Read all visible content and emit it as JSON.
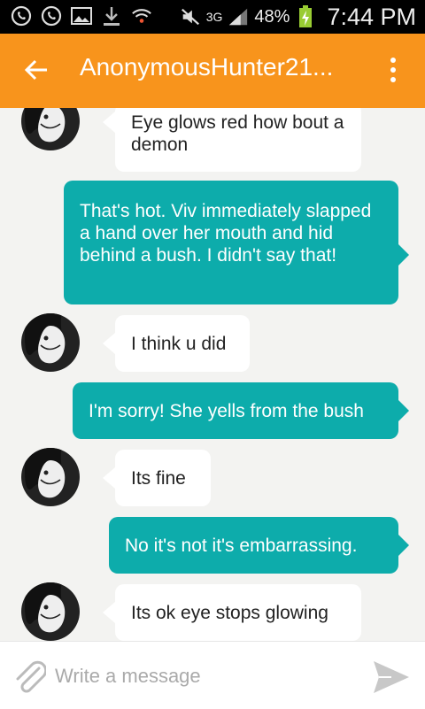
{
  "status_bar": {
    "icons": [
      "whatsapp-icon",
      "whatsapp-icon",
      "image-icon",
      "download-icon",
      "wifi-icon",
      "mute-icon",
      "3g-icon",
      "signal-icon",
      "battery-icon"
    ],
    "network": "3G",
    "battery": "48%",
    "time": "7:44 PM"
  },
  "app_bar": {
    "title": "AnonymousHunter21...",
    "back_icon": "arrow-left-icon",
    "menu_icon": "overflow-menu-icon",
    "color": "#f8941c"
  },
  "messages": [
    {
      "side": "in",
      "text": "Eye glows red how bout a demon"
    },
    {
      "side": "out",
      "text": "That's hot. Viv immediately slapped a hand over her mouth and hid behind a bush. I didn't say that!"
    },
    {
      "side": "in",
      "text": "I think u did"
    },
    {
      "side": "out",
      "text": "I'm sorry! She yells from the bush"
    },
    {
      "side": "in",
      "text": "Its fine"
    },
    {
      "side": "out",
      "text": "No it's not it's embarrassing."
    },
    {
      "side": "in",
      "text": "Its ok eye stops glowing"
    }
  ],
  "composer": {
    "placeholder": "Write a message",
    "attach_icon": "paperclip-icon",
    "send_icon": "send-icon"
  },
  "colors": {
    "outgoing_bubble": "#0dacab",
    "incoming_bubble": "#ffffff"
  }
}
